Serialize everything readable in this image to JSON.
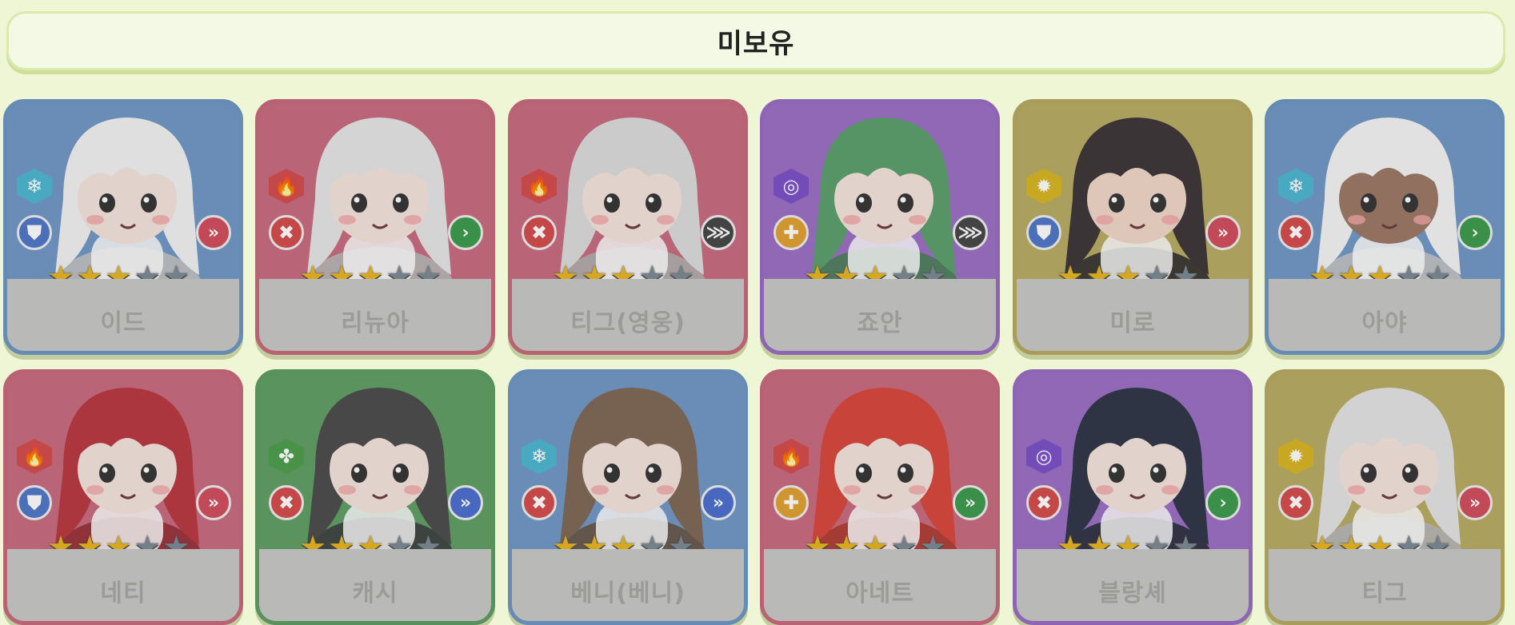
{
  "header": {
    "title": "미보유"
  },
  "colors": {
    "blue": "#6f97c4",
    "red": "#c86a7e",
    "purple": "#9a6ec4",
    "gold": "#b8ab63",
    "green": "#5f9e64"
  },
  "cards": [
    {
      "name": "이드",
      "bg": "blue",
      "element": "ice-icon",
      "element_color": "#4bb6d0",
      "element_glyph": "❄",
      "role": "shield-icon",
      "role_color": "#4d77c8",
      "role_glyph": "⛊",
      "rank": "chevron-double-icon",
      "rank_color": "#d24c5c",
      "rank_glyph": "»",
      "stars_filled": 3,
      "stars_total": 5,
      "hair": "#f2f2f2",
      "skin": "#f4e4dc"
    },
    {
      "name": "리뉴아",
      "bg": "red",
      "element": "fire-icon",
      "element_color": "#d44a4a",
      "element_glyph": "🔥",
      "role": "sword-icon",
      "role_color": "#d44a4a",
      "role_glyph": "✖",
      "rank": "chevron-icon",
      "rank_color": "#3a9a4a",
      "rank_glyph": "›",
      "stars_filled": 3,
      "stars_total": 5,
      "hair": "#e6e6e6",
      "skin": "#f4e4dc"
    },
    {
      "name": "티그(영웅)",
      "bg": "red",
      "element": "fire-icon",
      "element_color": "#d44a4a",
      "element_glyph": "🔥",
      "role": "sword-icon",
      "role_color": "#d44a4a",
      "role_glyph": "✖",
      "rank": "chevron-triple-icon",
      "rank_color": "#444444",
      "rank_glyph": "⋙",
      "stars_filled": 3,
      "stars_total": 5,
      "hair": "#dcdcdc",
      "skin": "#f4e4dc"
    },
    {
      "name": "죠안",
      "bg": "purple",
      "element": "spiral-icon",
      "element_color": "#7a4ec8",
      "element_glyph": "◎",
      "role": "cross-icon",
      "role_color": "#e0a030",
      "role_glyph": "✚",
      "rank": "chevron-triple-icon",
      "rank_color": "#444444",
      "rank_glyph": "⋙",
      "stars_filled": 3,
      "stars_total": 5,
      "hair": "#5a9e6a",
      "skin": "#f4e4dc"
    },
    {
      "name": "미로",
      "bg": "gold",
      "element": "sun-icon",
      "element_color": "#d9b520",
      "element_glyph": "✹",
      "role": "shield-icon",
      "role_color": "#4d77c8",
      "role_glyph": "⛊",
      "rank": "chevron-double-icon",
      "rank_color": "#d24c5c",
      "rank_glyph": "»",
      "stars_filled": 3,
      "stars_total": 5,
      "hair": "#3a3436",
      "skin": "#f1d6c8"
    },
    {
      "name": "아야",
      "bg": "blue",
      "element": "ice-icon",
      "element_color": "#4bb6d0",
      "element_glyph": "❄",
      "role": "sword-icon",
      "role_color": "#d44a4a",
      "role_glyph": "✖",
      "rank": "chevron-icon",
      "rank_color": "#3a9a4a",
      "rank_glyph": "›",
      "stars_filled": 3,
      "stars_total": 5,
      "hair": "#f4f4f4",
      "skin": "#9b7664"
    },
    {
      "name": "네티",
      "bg": "red",
      "element": "fire-icon",
      "element_color": "#d44a4a",
      "element_glyph": "🔥",
      "role": "shield-icon",
      "role_color": "#4d77c8",
      "role_glyph": "⛊",
      "rank": "chevron-double-icon",
      "rank_color": "#d24c5c",
      "rank_glyph": "»",
      "stars_filled": 3,
      "stars_total": 5,
      "hair": "#b8363e",
      "skin": "#f4e4dc"
    },
    {
      "name": "캐시",
      "bg": "green",
      "element": "clover-icon",
      "element_color": "#4a9e4a",
      "element_glyph": "✤",
      "role": "sword-icon",
      "role_color": "#d44a4a",
      "role_glyph": "✖",
      "rank": "chevron-double-icon",
      "rank_color": "#4a6ed0",
      "rank_glyph": "»",
      "stars_filled": 3,
      "stars_total": 5,
      "hair": "#4a4a4a",
      "skin": "#f4e4dc"
    },
    {
      "name": "베니(베니)",
      "bg": "blue",
      "element": "ice-icon",
      "element_color": "#4bb6d0",
      "element_glyph": "❄",
      "role": "sword-icon",
      "role_color": "#d44a4a",
      "role_glyph": "✖",
      "rank": "chevron-double-icon",
      "rank_color": "#4a6ed0",
      "rank_glyph": "»",
      "stars_filled": 3,
      "stars_total": 5,
      "hair": "#7e6654",
      "skin": "#f4e4dc"
    },
    {
      "name": "아네트",
      "bg": "red",
      "element": "fire-icon",
      "element_color": "#d44a4a",
      "element_glyph": "🔥",
      "role": "cross-icon",
      "role_color": "#e0a030",
      "role_glyph": "✚",
      "rank": "chevron-double-icon",
      "rank_color": "#3a9a4a",
      "rank_glyph": "»",
      "stars_filled": 3,
      "stars_total": 5,
      "hair": "#d9453a",
      "skin": "#f4e4dc"
    },
    {
      "name": "블랑셰",
      "bg": "purple",
      "element": "spiral-icon",
      "element_color": "#7a4ec8",
      "element_glyph": "◎",
      "role": "sword-icon",
      "role_color": "#d44a4a",
      "role_glyph": "✖",
      "rank": "chevron-icon",
      "rank_color": "#3a9a4a",
      "rank_glyph": "›",
      "stars_filled": 3,
      "stars_total": 5,
      "hair": "#2e3446",
      "skin": "#f4e4dc"
    },
    {
      "name": "티그",
      "bg": "gold",
      "element": "sun-icon",
      "element_color": "#d9b520",
      "element_glyph": "✹",
      "role": "sword-icon",
      "role_color": "#d44a4a",
      "role_glyph": "✖",
      "rank": "chevron-double-icon",
      "rank_color": "#d24c5c",
      "rank_glyph": "»",
      "stars_filled": 3,
      "stars_total": 5,
      "hair": "#e4e4e4",
      "skin": "#f4e4dc"
    }
  ]
}
